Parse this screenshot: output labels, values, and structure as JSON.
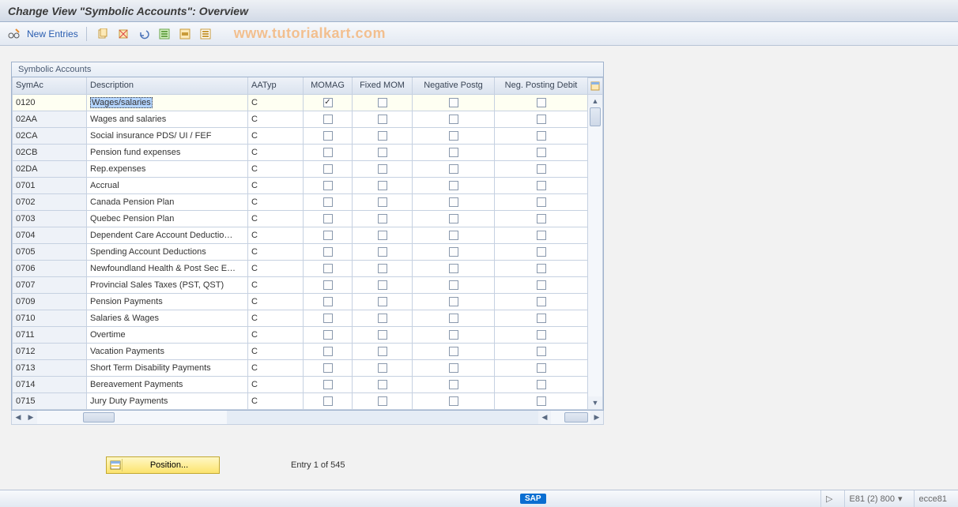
{
  "title": "Change View \"Symbolic Accounts\": Overview",
  "watermark": "www.tutorialkart.com",
  "toolbar": {
    "new_entries": "New Entries"
  },
  "panel": {
    "title": "Symbolic Accounts"
  },
  "columns": {
    "symac": "SymAc",
    "description": "Description",
    "aatyp": "AATyp",
    "momag": "MOMAG",
    "fixed_mom": "Fixed MOM",
    "neg_postg": "Negative Postg",
    "neg_posting_debit": "Neg. Posting Debit"
  },
  "rows": [
    {
      "symac": "0120",
      "description": "Wages/salaries",
      "aatyp": "C",
      "momag": true,
      "fixed_mom": false,
      "neg_postg": false,
      "neg_debit": false
    },
    {
      "symac": "02AA",
      "description": "Wages and salaries",
      "aatyp": "C",
      "momag": false,
      "fixed_mom": false,
      "neg_postg": false,
      "neg_debit": false
    },
    {
      "symac": "02CA",
      "description": "Social insurance PDS/ UI / FEF",
      "aatyp": "C",
      "momag": false,
      "fixed_mom": false,
      "neg_postg": false,
      "neg_debit": false
    },
    {
      "symac": "02CB",
      "description": "Pension fund expenses",
      "aatyp": "C",
      "momag": false,
      "fixed_mom": false,
      "neg_postg": false,
      "neg_debit": false
    },
    {
      "symac": "02DA",
      "description": "Rep.expenses",
      "aatyp": "C",
      "momag": false,
      "fixed_mom": false,
      "neg_postg": false,
      "neg_debit": false
    },
    {
      "symac": "0701",
      "description": "Accrual",
      "aatyp": "C",
      "momag": false,
      "fixed_mom": false,
      "neg_postg": false,
      "neg_debit": false
    },
    {
      "symac": "0702",
      "description": "Canada Pension Plan",
      "aatyp": "C",
      "momag": false,
      "fixed_mom": false,
      "neg_postg": false,
      "neg_debit": false
    },
    {
      "symac": "0703",
      "description": "Quebec Pension Plan",
      "aatyp": "C",
      "momag": false,
      "fixed_mom": false,
      "neg_postg": false,
      "neg_debit": false
    },
    {
      "symac": "0704",
      "description": "Dependent Care Account Deductio…",
      "aatyp": "C",
      "momag": false,
      "fixed_mom": false,
      "neg_postg": false,
      "neg_debit": false
    },
    {
      "symac": "0705",
      "description": "Spending Account Deductions",
      "aatyp": "C",
      "momag": false,
      "fixed_mom": false,
      "neg_postg": false,
      "neg_debit": false
    },
    {
      "symac": "0706",
      "description": "Newfoundland Health & Post Sec E…",
      "aatyp": "C",
      "momag": false,
      "fixed_mom": false,
      "neg_postg": false,
      "neg_debit": false
    },
    {
      "symac": "0707",
      "description": "Provincial Sales Taxes (PST, QST)",
      "aatyp": "C",
      "momag": false,
      "fixed_mom": false,
      "neg_postg": false,
      "neg_debit": false
    },
    {
      "symac": "0709",
      "description": "Pension Payments",
      "aatyp": "C",
      "momag": false,
      "fixed_mom": false,
      "neg_postg": false,
      "neg_debit": false
    },
    {
      "symac": "0710",
      "description": "Salaries & Wages",
      "aatyp": "C",
      "momag": false,
      "fixed_mom": false,
      "neg_postg": false,
      "neg_debit": false
    },
    {
      "symac": "0711",
      "description": "Overtime",
      "aatyp": "C",
      "momag": false,
      "fixed_mom": false,
      "neg_postg": false,
      "neg_debit": false
    },
    {
      "symac": "0712",
      "description": "Vacation Payments",
      "aatyp": "C",
      "momag": false,
      "fixed_mom": false,
      "neg_postg": false,
      "neg_debit": false
    },
    {
      "symac": "0713",
      "description": "Short Term Disability Payments",
      "aatyp": "C",
      "momag": false,
      "fixed_mom": false,
      "neg_postg": false,
      "neg_debit": false
    },
    {
      "symac": "0714",
      "description": "Bereavement Payments",
      "aatyp": "C",
      "momag": false,
      "fixed_mom": false,
      "neg_postg": false,
      "neg_debit": false
    },
    {
      "symac": "0715",
      "description": "Jury Duty Payments",
      "aatyp": "C",
      "momag": false,
      "fixed_mom": false,
      "neg_postg": false,
      "neg_debit": false
    }
  ],
  "position_button": "Position...",
  "entry_text": "Entry 1 of 545",
  "status": {
    "sap": "SAP",
    "system": "E81 (2) 800",
    "server": "ecce81"
  }
}
